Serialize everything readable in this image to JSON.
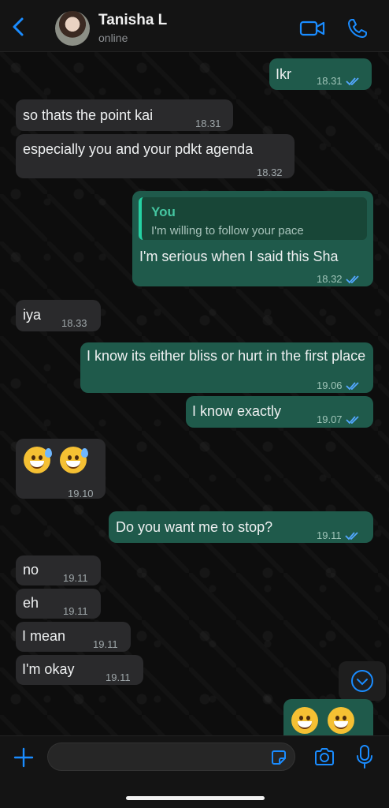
{
  "header": {
    "contact_name": "Tanisha L",
    "status": "online",
    "icons": {
      "back": "chevron-left-icon",
      "video": "video-camera-icon",
      "call": "phone-icon"
    }
  },
  "messages": [
    {
      "from": "me",
      "text": "Ikr",
      "time": "18.31",
      "read": true
    },
    {
      "from": "them",
      "text": "so thats the point kai",
      "time": "18.31"
    },
    {
      "from": "them",
      "text": "especially you and your pdkt agenda",
      "time": "18.32"
    },
    {
      "from": "me",
      "reply_author": "You",
      "reply_text": "I'm willing to follow your pace",
      "text": "I'm serious when I said this Sha",
      "time": "18.32",
      "read": true
    },
    {
      "from": "them",
      "text": "iya",
      "time": "18.33"
    },
    {
      "from": "me",
      "text": "I know its either bliss or hurt in the first place",
      "time": "19.06",
      "read": true
    },
    {
      "from": "me",
      "text": "I know exactly",
      "time": "19.07",
      "read": true
    },
    {
      "from": "them",
      "text": "😅 😅",
      "time": "19.10"
    },
    {
      "from": "me",
      "text": "Do you want me to stop?",
      "time": "19.11",
      "read": true
    },
    {
      "from": "them",
      "text": "no",
      "time": "19.11"
    },
    {
      "from": "them",
      "text": "eh",
      "time": "19.11"
    },
    {
      "from": "them",
      "text": "I mean",
      "time": "19.11"
    },
    {
      "from": "them",
      "text": "I'm okay",
      "time": "19.11"
    },
    {
      "from": "me",
      "text": "😁 😁",
      "time": ""
    }
  ],
  "composer": {
    "placeholder": ""
  },
  "colors": {
    "incoming": "#2a2a2c",
    "outgoing": "#1f5a4b",
    "accent": "#1a8cff",
    "tick": "#53a7ff"
  }
}
